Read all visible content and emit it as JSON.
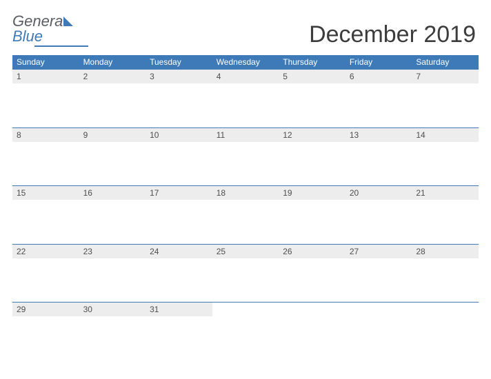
{
  "logo": {
    "part1": "Genera",
    "part2": "Blue"
  },
  "title": "December 2019",
  "days": [
    "Sunday",
    "Monday",
    "Tuesday",
    "Wednesday",
    "Thursday",
    "Friday",
    "Saturday"
  ],
  "weeks": [
    [
      "1",
      "2",
      "3",
      "4",
      "5",
      "6",
      "7"
    ],
    [
      "8",
      "9",
      "10",
      "11",
      "12",
      "13",
      "14"
    ],
    [
      "15",
      "16",
      "17",
      "18",
      "19",
      "20",
      "21"
    ],
    [
      "22",
      "23",
      "24",
      "25",
      "26",
      "27",
      "28"
    ],
    [
      "29",
      "30",
      "31",
      "",
      "",
      "",
      ""
    ]
  ]
}
